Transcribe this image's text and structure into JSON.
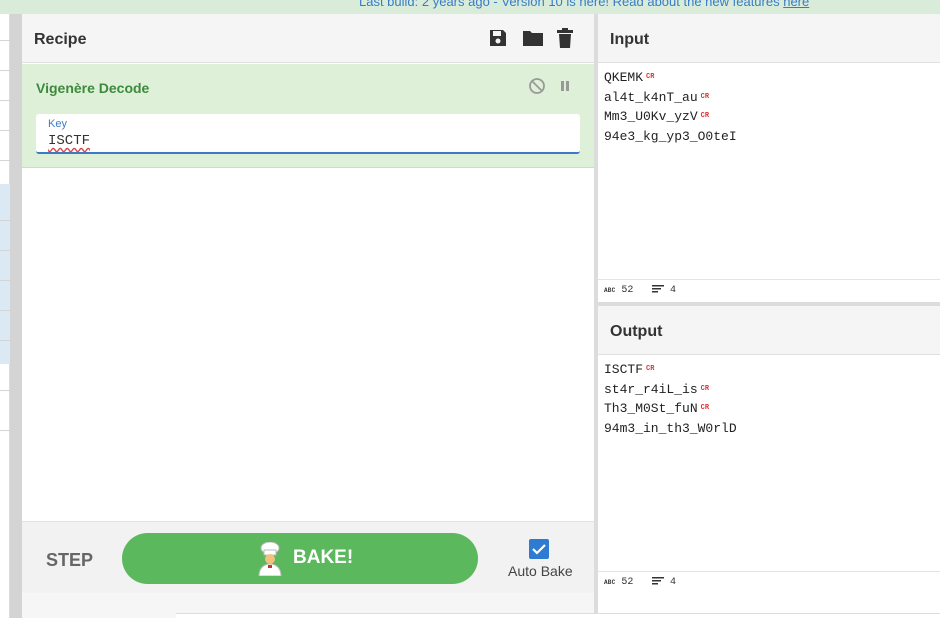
{
  "banner": {
    "prefix": "Last build: 2 years ago - Version 10 is here! Read about the new features ",
    "link": "here"
  },
  "recipe": {
    "title": "Recipe",
    "icons": [
      "save-icon",
      "folder-icon",
      "trash-icon"
    ],
    "operation": {
      "name": "Vigenère Decode",
      "key_label": "Key",
      "key_value": "ISCTF"
    },
    "controls": {
      "step_label": "STEP",
      "bake_label": "BAKE!",
      "auto_bake_label": "Auto Bake",
      "auto_bake_checked": true
    }
  },
  "input": {
    "title": "Input",
    "lines": [
      {
        "text": "QKEMK",
        "cr": "CR"
      },
      {
        "text": "al4t_k4nT_au",
        "cr": "CR"
      },
      {
        "text": "Mm3_U0Kv_yzV",
        "cr": "CR"
      },
      {
        "text": "94e3_kg_yp3_O0teI",
        "cr": ""
      }
    ],
    "status": {
      "length_label": "ABC",
      "length": "52",
      "lines": "4"
    }
  },
  "output": {
    "title": "Output",
    "lines": [
      {
        "text": "ISCTF",
        "cr": "CR"
      },
      {
        "text": "st4r_r4iL_is",
        "cr": "CR"
      },
      {
        "text": "Th3_M0St_fuN",
        "cr": "CR"
      },
      {
        "text": "94m3_in_th3_W0rlD",
        "cr": ""
      }
    ],
    "status": {
      "length_label": "ABC",
      "length": "52",
      "lines": "4"
    }
  },
  "colors": {
    "accent": "#5cb85c",
    "operation_bg": "#dff0d8",
    "link": "#3a7bc8",
    "checkbox": "#2e7bd1"
  }
}
